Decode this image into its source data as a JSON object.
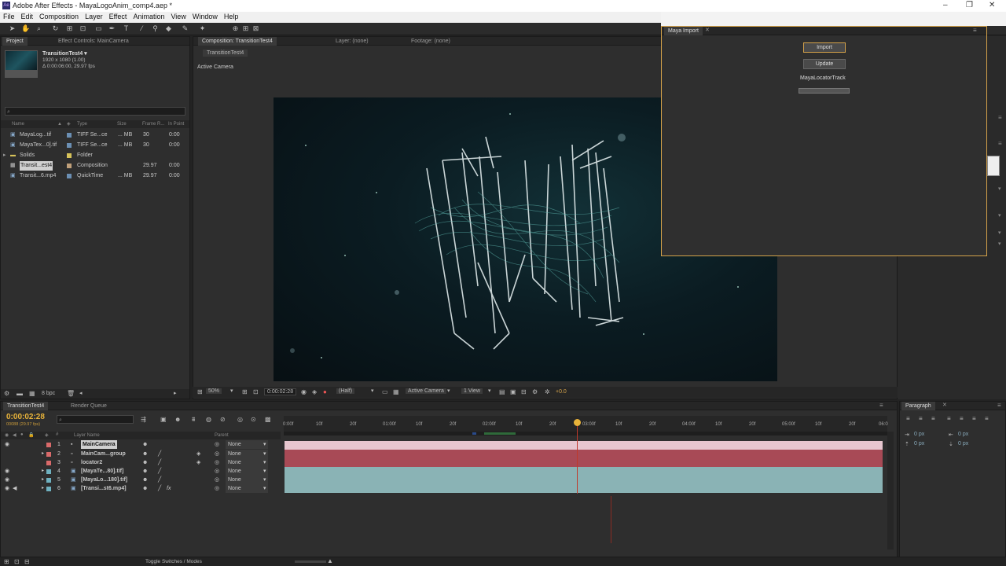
{
  "window": {
    "title": "Adobe After Effects - MayaLogoAnim_comp4.aep *",
    "logo_text": "Ae"
  },
  "menu": [
    "File",
    "Edit",
    "Composition",
    "Layer",
    "Effect",
    "Animation",
    "View",
    "Window",
    "Help"
  ],
  "project_panel": {
    "tab_project": "Project",
    "tab_effect_controls": "Effect Controls: MainCamera",
    "comp_name": "TransitionTest4 ▾",
    "comp_size": "1920 x 1080 (1.00)",
    "comp_duration": "Δ 0:00:06:00, 29.97 fps",
    "columns": [
      "Name",
      "Type",
      "Size",
      "Frame R...",
      "In Point"
    ],
    "items": [
      {
        "name": "MayaLog...tif",
        "type": "TIFF Se...ce",
        "size": "... MB",
        "fps": "30",
        "in": "0:00",
        "color": "#6b8fb3"
      },
      {
        "name": "MayaTex...0].tif",
        "type": "TIFF Se...ce",
        "size": "... MB",
        "fps": "30",
        "in": "0:00",
        "color": "#6b8fb3"
      },
      {
        "name": "Solids",
        "type": "Folder",
        "size": "",
        "fps": "",
        "in": "",
        "color": "#d6c25a"
      },
      {
        "name": "Transit...est4",
        "type": "Composition",
        "size": "",
        "fps": "29.97",
        "in": "0:00",
        "color": "#c0a07a"
      },
      {
        "name": "Transit...6.mp4",
        "type": "QuickTime",
        "size": "... MB",
        "fps": "29.97",
        "in": "0:00",
        "color": "#6b8fb3"
      }
    ],
    "bpc": "8 bpc"
  },
  "composition_panel": {
    "tab_comp": "Composition: TransitionTest4",
    "tab_layer": "Layer: (none)",
    "tab_footage": "Footage: (none)",
    "breadcrumb": "TransitionTest4",
    "camera_label": "Active Camera",
    "zoom": "50%",
    "timecode": "0:00:02:28",
    "resolution": "(Half)",
    "camera_select": "Active Camera",
    "view_select": "1 View",
    "exposure": "+0.0"
  },
  "maya_import": {
    "tab": "Maya Import",
    "import_label": "Import",
    "update_label": "Update",
    "track_label": "MayaLocatorTrack"
  },
  "timeline": {
    "tab": "TransitionTest4",
    "tab_render": "Render Queue",
    "timecode": "0:00:02:28",
    "frame_info": "00088 (29.97 fps)",
    "col_layer_name": "Layer Name",
    "col_parent": "Parent",
    "ruler": [
      "0:00f",
      "10f",
      "20f",
      "01:00f",
      "10f",
      "20f",
      "02:00f",
      "10f",
      "20f",
      "03:00f",
      "10f",
      "20f",
      "04:00f",
      "10f",
      "20f",
      "05:00f",
      "10f",
      "20f",
      "06:0"
    ],
    "layers": [
      {
        "num": "1",
        "name": "MainCamera",
        "parent": "None",
        "color": "#d96a6a",
        "bar": "#e7c6cf",
        "selected": true
      },
      {
        "num": "2",
        "name": "MainCam...group",
        "parent": "None",
        "color": "#d96a6a",
        "bar": "#a84a56",
        "selected": false
      },
      {
        "num": "3",
        "name": "locator2",
        "parent": "None",
        "color": "#d96a6a",
        "bar": "#a84a56",
        "selected": false
      },
      {
        "num": "4",
        "name": "[MayaTe...80].tif]",
        "parent": "None",
        "color": "#6fb1c0",
        "bar": "#8ab3b5",
        "selected": false
      },
      {
        "num": "5",
        "name": "[MayaLo...180].tif]",
        "parent": "None",
        "color": "#6fb1c0",
        "bar": "#8ab3b5",
        "selected": false
      },
      {
        "num": "6",
        "name": "[Transi...st6.mp4]",
        "parent": "None",
        "color": "#6fb1c0",
        "bar": "#8ab3b5",
        "selected": false
      }
    ],
    "toggle_label": "Toggle Switches / Modes"
  },
  "paragraph_panel": {
    "tab": "Paragraph",
    "field1": "0 px",
    "field2": "0 px",
    "field3": "0 px",
    "field4": "0 px"
  },
  "colors": {
    "accent_orange": "#d4a24a",
    "timecode_yellow": "#e8b33a",
    "playhead_red": "#c0392b"
  }
}
